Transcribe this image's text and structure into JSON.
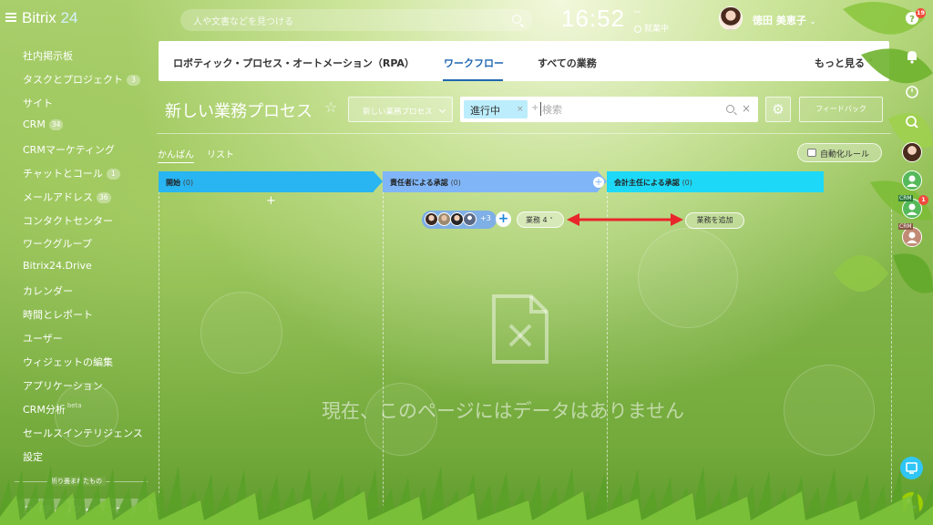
{
  "app": {
    "logo_text": "Bitrix",
    "logo_num": "24",
    "search_placeholder": "人や文書などを見つける"
  },
  "clock": {
    "time": "16:52",
    "sub_top": "ꟷ",
    "status": "就業中"
  },
  "user": {
    "name": "徳田 美恵子",
    "name_suffix": "⌄"
  },
  "sidebar": {
    "items": [
      {
        "label": "社内掲示板",
        "badge": ""
      },
      {
        "label": "タスクとプロジェクト",
        "badge": "3"
      },
      {
        "label": "サイト",
        "badge": ""
      },
      {
        "label": "CRM",
        "badge": "34"
      },
      {
        "label": "CRMマーケティング",
        "badge": ""
      },
      {
        "label": "チャットとコール",
        "badge": "1"
      },
      {
        "label": "メールアドレス",
        "badge": "36"
      },
      {
        "label": "コンタクトセンター",
        "badge": ""
      },
      {
        "label": "ワークグループ",
        "badge": ""
      },
      {
        "label": "Bitrix24.Drive",
        "badge": ""
      },
      {
        "label": "カレンダー",
        "badge": ""
      },
      {
        "label": "時間とレポート",
        "badge": ""
      },
      {
        "label": "ユーザー",
        "badge": ""
      },
      {
        "label": "ウィジェットの編集",
        "badge": ""
      },
      {
        "label": "アプリケーション",
        "badge": ""
      },
      {
        "label": "CRM分析",
        "badge": "",
        "beta": "beta"
      },
      {
        "label": "セールスインテリジェンス",
        "badge": ""
      },
      {
        "label": "設定",
        "badge": ""
      }
    ],
    "collapsed_label": "折り畳まれたもの",
    "active_item": "ロボティック・プロセ..."
  },
  "main_menu": {
    "items": [
      "ロボティック・プロセス・オートメーション（RPA）",
      "ワークフロー",
      "すべての業務"
    ],
    "active_index": 1,
    "more": "もっと見る ˅"
  },
  "toolbar": {
    "title": "新しい業務プロセス",
    "star": "☆",
    "new_button": "新しい業務プロセス",
    "filter_chip": "進行中",
    "filter_chip_x": "×",
    "filter_plus": "+",
    "filter_placeholder": "検索",
    "filter_clear": "×",
    "gear": "⚙",
    "feedback": "フィードバック"
  },
  "views": {
    "tabs": [
      "かんばん",
      "リスト"
    ],
    "auto_rule": "自動化ルール"
  },
  "kanban": {
    "columns": [
      {
        "title": "開始",
        "count": "(0)",
        "color": "#28b5f2"
      },
      {
        "title": "責任者による承認",
        "count": "(0)",
        "color": "#80b6f8"
      },
      {
        "title": "会計主任による承認",
        "count": "(0)",
        "color": "#1dd9f7"
      }
    ],
    "add_plus": "+",
    "members_more": "+3",
    "add_member": "+",
    "task_label": "業務",
    "task_count": "4",
    "task_chevron": "˅",
    "add_task": "業務を追加"
  },
  "empty_state": {
    "text": "現在、このページにはデータはありません"
  },
  "right_rail": {
    "help_badge": "19",
    "crm_label_1": "CRM",
    "crm_badge": "1",
    "crm_label_2": "CRM"
  },
  "colors": {
    "accent": "#2067b0",
    "arrow_red": "#e8262b",
    "badge_red": "#f04a3c"
  }
}
